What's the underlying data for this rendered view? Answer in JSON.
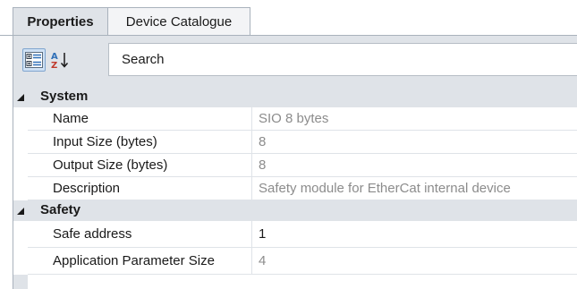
{
  "tabs": [
    {
      "label": "Properties",
      "active": true
    },
    {
      "label": "Device Catalogue",
      "active": false
    }
  ],
  "toolbar": {
    "categorized_icon": "categorized-view-icon",
    "alphabetical_icon": "sort-alphabetical-icon",
    "search_text": "Search"
  },
  "categories": [
    {
      "label": "System",
      "expanded": true,
      "properties": [
        {
          "name": "Name",
          "value": "SIO 8 bytes",
          "read_only": true
        },
        {
          "name": "Input Size (bytes)",
          "value": "8",
          "read_only": true
        },
        {
          "name": "Output Size (bytes)",
          "value": "8",
          "read_only": true
        },
        {
          "name": "Description",
          "value": "Safety module for EtherCat internal device",
          "read_only": true
        }
      ]
    },
    {
      "label": "Safety",
      "expanded": true,
      "properties": [
        {
          "name": "Safe address",
          "value": "1",
          "read_only": false
        },
        {
          "name": "Application Parameter Size",
          "value": "4",
          "read_only": true
        }
      ]
    }
  ],
  "colors": {
    "chrome": "#dfe3e8",
    "border": "#a9b2bc",
    "read_only_text": "#8c8c8c",
    "text": "#1a1a1a",
    "selected_button": "#cfe1f4"
  }
}
